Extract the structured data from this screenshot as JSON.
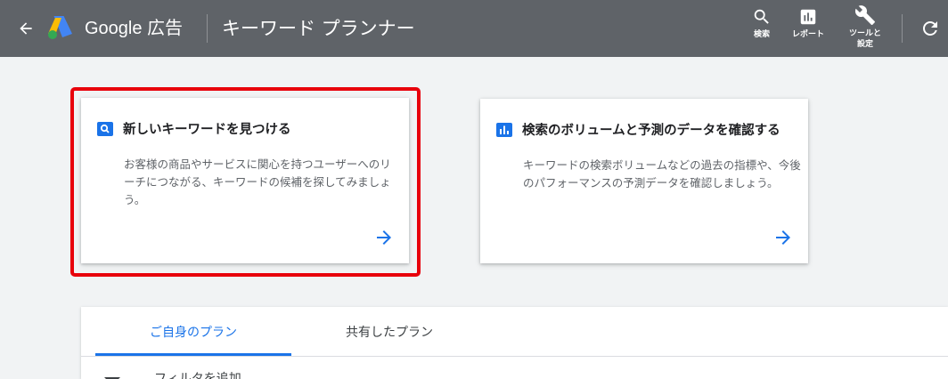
{
  "header": {
    "brand": "Google 広告",
    "title": "キーワード プランナー",
    "tools": {
      "search": "検索",
      "report": "レポート",
      "settings_line1": "ツールと",
      "settings_line2": "設定"
    },
    "icons": [
      "arrow-back-icon",
      "google-ads-logo",
      "search-icon",
      "report-icon",
      "wrench-icon",
      "refresh-icon"
    ]
  },
  "cards": [
    {
      "title": "新しいキーワードを見つける",
      "description": "お客様の商品やサービスに関心を持つユーザーへのリーチにつながる、キーワードの候補を探してみましょう。",
      "icon": "search-icon",
      "highlighted": true
    },
    {
      "title": "検索のボリュームと予測のデータを確認する",
      "description": "キーワードの検索ボリュームなどの過去の指標や、今後のパフォーマンスの予測データを確認しましょう。",
      "icon": "bar-chart-icon",
      "highlighted": false
    }
  ],
  "plans": {
    "tabs": [
      {
        "label": "ご自身のプラン",
        "active": true
      },
      {
        "label": "共有したプラン",
        "active": false
      }
    ],
    "filter_label": "フィルタを追加"
  },
  "colors": {
    "header_bg": "#5f6368",
    "page_bg": "#f1f3f4",
    "accent": "#1a73e8",
    "highlight": "#e8000b"
  }
}
